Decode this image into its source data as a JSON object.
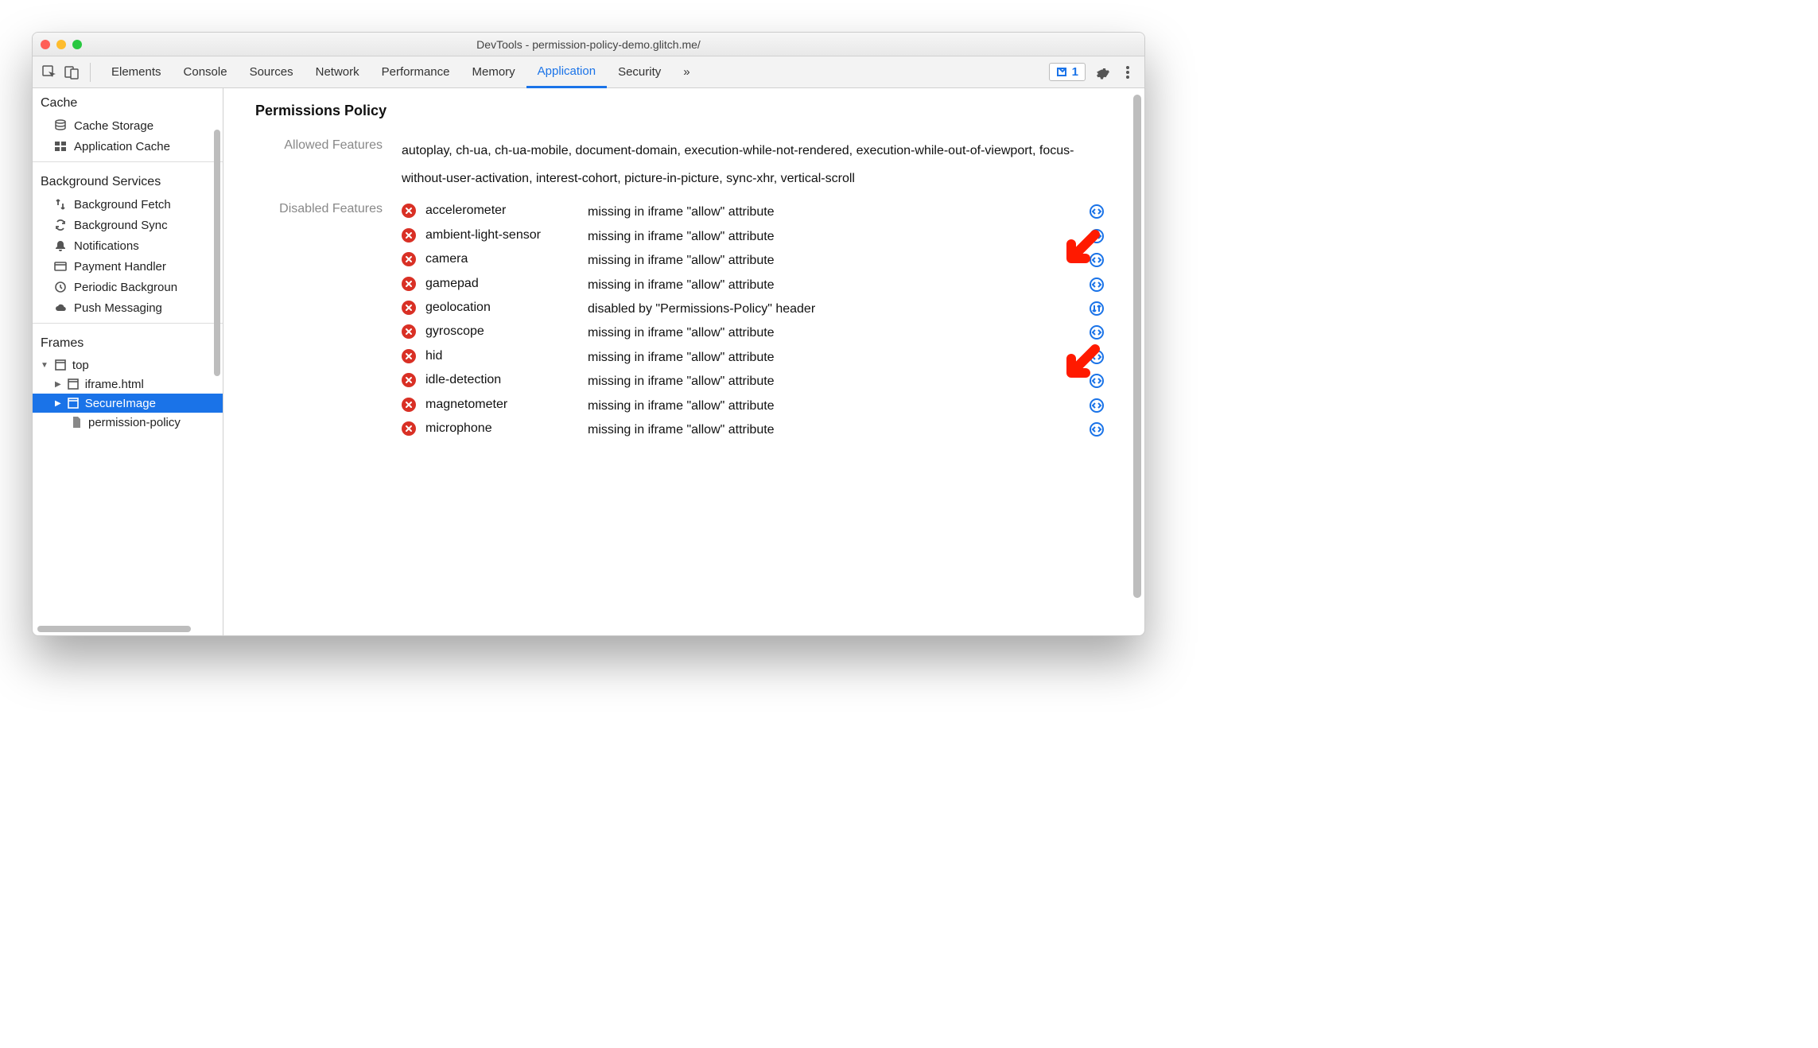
{
  "window": {
    "title": "DevTools - permission-policy-demo.glitch.me/"
  },
  "toolbar": {
    "tabs": [
      "Elements",
      "Console",
      "Sources",
      "Network",
      "Performance",
      "Memory",
      "Application",
      "Security"
    ],
    "activeTab": "Application",
    "badgeCount": "1"
  },
  "sidebar": {
    "cache": {
      "title": "Cache",
      "items": [
        "Cache Storage",
        "Application Cache"
      ]
    },
    "bgServices": {
      "title": "Background Services",
      "items": [
        "Background Fetch",
        "Background Sync",
        "Notifications",
        "Payment Handler",
        "Periodic Backgroun",
        "Push Messaging"
      ]
    },
    "frames": {
      "title": "Frames",
      "top": "top",
      "children": [
        "iframe.html",
        "SecureImage",
        "permission-policy"
      ],
      "selected": "SecureImage"
    }
  },
  "main": {
    "title": "Permissions Policy",
    "allowedLabel": "Allowed Features",
    "allowedText": "autoplay, ch-ua, ch-ua-mobile, document-domain, execution-while-not-rendered, execution-while-out-of-viewport, focus-without-user-activation, interest-cohort, picture-in-picture, sync-xhr, vertical-scroll",
    "disabledLabel": "Disabled Features",
    "disabled": [
      {
        "name": "accelerometer",
        "reason": "missing in iframe \"allow\" attribute",
        "icon": "code"
      },
      {
        "name": "ambient-light-sensor",
        "reason": "missing in iframe \"allow\" attribute",
        "icon": "code"
      },
      {
        "name": "camera",
        "reason": "missing in iframe \"allow\" attribute",
        "icon": "code"
      },
      {
        "name": "gamepad",
        "reason": "missing in iframe \"allow\" attribute",
        "icon": "code"
      },
      {
        "name": "geolocation",
        "reason": "disabled by \"Permissions-Policy\" header",
        "icon": "swap"
      },
      {
        "name": "gyroscope",
        "reason": "missing in iframe \"allow\" attribute",
        "icon": "code"
      },
      {
        "name": "hid",
        "reason": "missing in iframe \"allow\" attribute",
        "icon": "code"
      },
      {
        "name": "idle-detection",
        "reason": "missing in iframe \"allow\" attribute",
        "icon": "code"
      },
      {
        "name": "magnetometer",
        "reason": "missing in iframe \"allow\" attribute",
        "icon": "code"
      },
      {
        "name": "microphone",
        "reason": "missing in iframe \"allow\" attribute",
        "icon": "code"
      }
    ]
  }
}
